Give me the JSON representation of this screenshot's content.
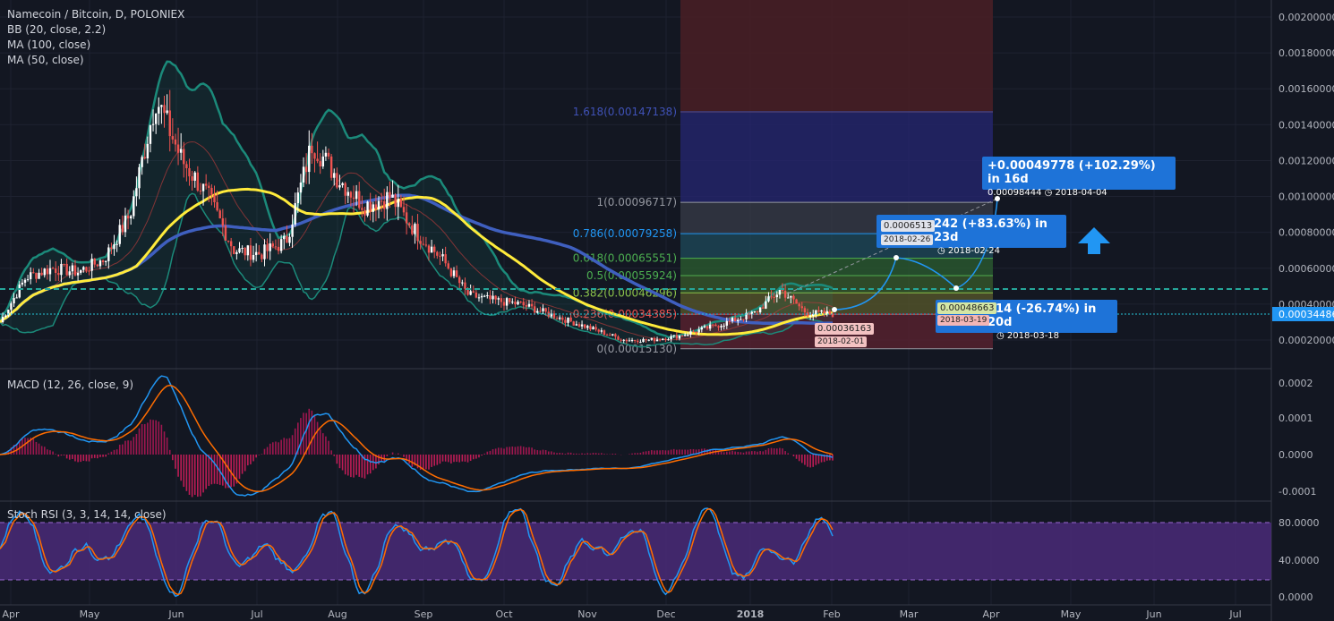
{
  "legend": {
    "title": "Namecoin / Bitcoin, D, POLONIEX",
    "bb": "BB (20, close, 2.2)",
    "ma100": "MA (100, close)",
    "ma50": "MA (50, close)",
    "macd": "MACD (12, 26, close, 9)",
    "stoch": "Stoch RSI (3, 3, 14, 14, close)"
  },
  "colors": {
    "background": "#131722",
    "up": "#ffffff",
    "down": "#ef5350",
    "ma50": "#ffeb3b",
    "ma100": "#3f5fbf",
    "bb": "#1b8a7a",
    "price_tag": "#2196f3",
    "macd_line": "#2196f3",
    "signal_line": "#ff6d00",
    "stoch_band": "#4a2a78"
  },
  "price_axis": {
    "labels": [
      "0.00200000",
      "0.00180000",
      "0.00160000",
      "0.00140000",
      "0.00120000",
      "0.00100000",
      "0.00080000",
      "0.00060000",
      "0.00040000",
      "0.00020000"
    ],
    "current": "0.00034486"
  },
  "macd_axis": {
    "labels": [
      "0.0002",
      "0.0001",
      "0.0000",
      "-0.0001"
    ]
  },
  "stoch_axis": {
    "labels": [
      "80.0000",
      "40.0000",
      "0.0000"
    ]
  },
  "time_axis": {
    "labels": [
      "Apr",
      "May",
      "Jun",
      "Jul",
      "Aug",
      "Sep",
      "Oct",
      "Nov",
      "Dec",
      "2018",
      "Feb",
      "Mar",
      "Apr",
      "May",
      "Jun",
      "Jul"
    ]
  },
  "fib_levels": [
    {
      "label": "1.618(0.00147138)",
      "value": 0.00147138
    },
    {
      "label": "1(0.00096717)",
      "value": 0.00096717
    },
    {
      "label": "0.786(0.00079258)",
      "value": 0.00079258
    },
    {
      "label": "0.618(0.00065551)",
      "value": 0.00065551
    },
    {
      "label": "0.5(0.00055924)",
      "value": 0.00055924
    },
    {
      "label": "0.382(0.00046296)",
      "value": 0.00046296
    },
    {
      "label": "0.236(0.00034385)",
      "value": 0.00034385
    },
    {
      "label": "0(0.00015130)",
      "value": 0.0001513
    }
  ],
  "callouts": {
    "c1": {
      "title": "+0.00049778 (+102.29%) in 16d",
      "price": "0.00098444",
      "date": "2018-04-04"
    },
    "c2": {
      "title": "242 (+83.63%) in 23d",
      "price_tag": "0.0006513",
      "date_tag": "2018-02-26",
      "date": "2018-02-24"
    },
    "c3": {
      "title": "414 (-26.74%) in 20d",
      "price_tag": "0.00048663",
      "date_tag": "2018-03-19",
      "date": "2018-03-18"
    },
    "c4": {
      "price_tag": "0.00036163",
      "date_tag": "2018-02-01"
    }
  },
  "chart_data": {
    "type": "candlestick",
    "title": "Namecoin / Bitcoin, D, POLONIEX",
    "x": [
      "Apr",
      "May",
      "Jun",
      "Jul",
      "Aug",
      "Sep",
      "Oct",
      "Nov",
      "Dec",
      "2018",
      "Feb",
      "Mar",
      "Apr",
      "May",
      "Jun",
      "Jul"
    ],
    "ylim": [
      0.0001,
      0.0021
    ],
    "close_path": [
      [
        "Apr",
        0.0003
      ],
      [
        "Apr",
        0.00055
      ],
      [
        "Apr",
        0.0006
      ],
      [
        "Apr",
        0.00058
      ],
      [
        "Apr",
        0.00065
      ],
      [
        "May",
        0.0009
      ],
      [
        "May",
        0.00155
      ],
      [
        "May",
        0.0012
      ],
      [
        "May",
        0.001
      ],
      [
        "Jun",
        0.0007
      ],
      [
        "Jun",
        0.00068
      ],
      [
        "Jun",
        0.00075
      ],
      [
        "Jul",
        0.0013
      ],
      [
        "Jul",
        0.0011
      ],
      [
        "Jul",
        0.00095
      ],
      [
        "Jul",
        0.001
      ],
      [
        "Aug",
        0.0008
      ],
      [
        "Aug",
        0.00065
      ],
      [
        "Aug",
        0.00045
      ],
      [
        "Sep",
        0.00042
      ],
      [
        "Sep",
        0.0004
      ],
      [
        "Sep",
        0.00035
      ],
      [
        "Oct",
        0.0003
      ],
      [
        "Oct",
        0.00025
      ],
      [
        "Nov",
        0.0002
      ],
      [
        "Nov",
        0.0002
      ],
      [
        "Dec",
        0.00022
      ],
      [
        "Dec",
        0.00026
      ],
      [
        "Dec",
        0.0003
      ],
      [
        "2018",
        0.00035
      ],
      [
        "2018",
        0.00048
      ],
      [
        "2018",
        0.00035
      ],
      [
        "2018",
        0.00034486
      ]
    ],
    "projection": [
      {
        "date": "2018-02-01",
        "price": 0.00036163
      },
      {
        "date": "2018-02-24",
        "price": 0.0006513
      },
      {
        "date": "2018-03-18",
        "price": 0.00048663
      },
      {
        "date": "2018-04-04",
        "price": 0.00098444
      }
    ],
    "dashed_level": 0.00048
  }
}
